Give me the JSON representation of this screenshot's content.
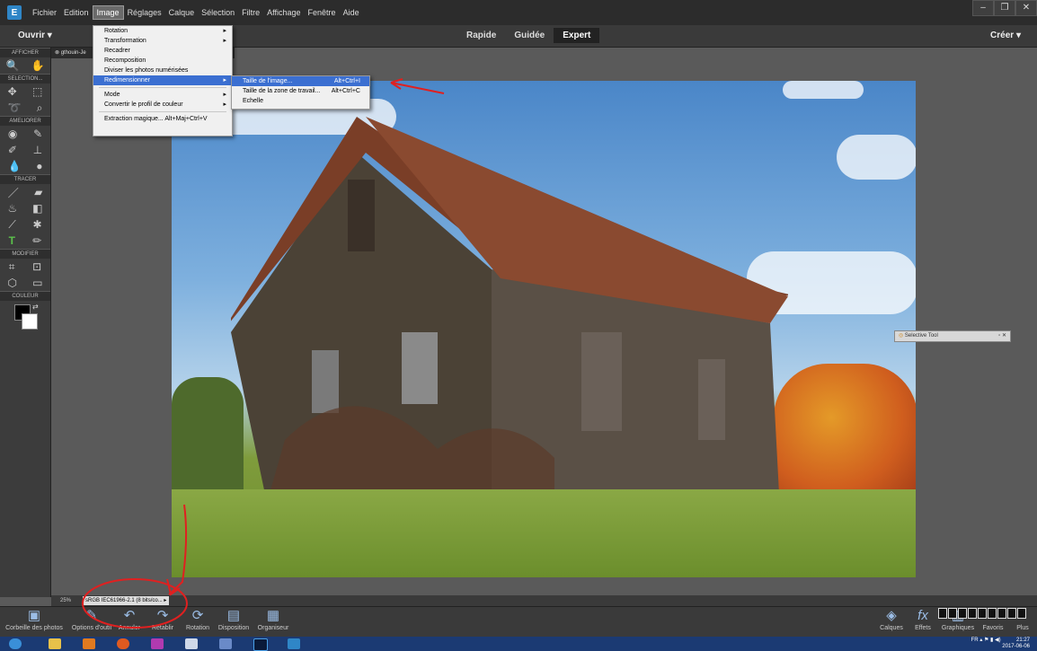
{
  "menubar": {
    "items": [
      "Fichier",
      "Edition",
      "Image",
      "Réglages",
      "Calque",
      "Sélection",
      "Filtre",
      "Affichage",
      "Fenêtre",
      "Aide"
    ],
    "active_index": 2
  },
  "toolbar": {
    "open_label": "Ouvrir",
    "modes": [
      "Rapide",
      "Guidée",
      "Expert"
    ],
    "active_mode": "Expert",
    "create_label": "Créer"
  },
  "tools_panel": {
    "sections": [
      "AFFICHER",
      "SELECTION...",
      "AMELIORER",
      "TRACER",
      "MODIFIER",
      "COULEUR"
    ]
  },
  "document": {
    "tab_title": "gthouin-Je"
  },
  "image_menu": {
    "items": [
      {
        "label": "Rotation",
        "submenu": true
      },
      {
        "label": "Transformation",
        "submenu": true
      },
      {
        "label": "Recadrer"
      },
      {
        "label": "Recomposition"
      },
      {
        "label": "Diviser les photos numérisées"
      },
      {
        "label": "Redimensionner",
        "submenu": true,
        "selected": true
      },
      {
        "sep": true
      },
      {
        "label": "Mode",
        "submenu": true
      },
      {
        "label": "Convertir le profil de couleur",
        "submenu": true
      },
      {
        "sep": true
      },
      {
        "label": "Extraction magique...",
        "shortcut": "Alt+Maj+Ctrl+V"
      }
    ]
  },
  "resize_submenu": {
    "items": [
      {
        "label": "Taille de l'image...",
        "shortcut": "Alt+Ctrl+I",
        "selected": true
      },
      {
        "label": "Taille de la zone de travail...",
        "shortcut": "Alt+Ctrl+C"
      },
      {
        "label": "Echelle"
      }
    ]
  },
  "status_bar": {
    "zoom": "25%",
    "profile": "sRGB IEC61966-2.1 (8 bits/co..."
  },
  "bottom_bar": {
    "left_items": [
      "Corbeille des photos",
      "Options d'outil",
      "Annuler",
      "Rétablir",
      "Rotation",
      "Disposition",
      "Organiseur"
    ],
    "right_items": [
      "Calques",
      "Effets",
      "Graphiques",
      "Favoris",
      "Plus"
    ]
  },
  "selective_tool": {
    "title": "Selective Tool"
  },
  "taskbar": {
    "lang": "FR",
    "time": "21:27",
    "date": "2017-06-06"
  },
  "colors": {
    "menubar_bg": "#2c2c2c",
    "panel_bg": "#3c3c3c",
    "workspace_bg": "#5a5a5a",
    "menu_highlight": "#3b6fd1",
    "annotation_red": "#e02020",
    "taskbar_bg": "#1b3a73"
  }
}
